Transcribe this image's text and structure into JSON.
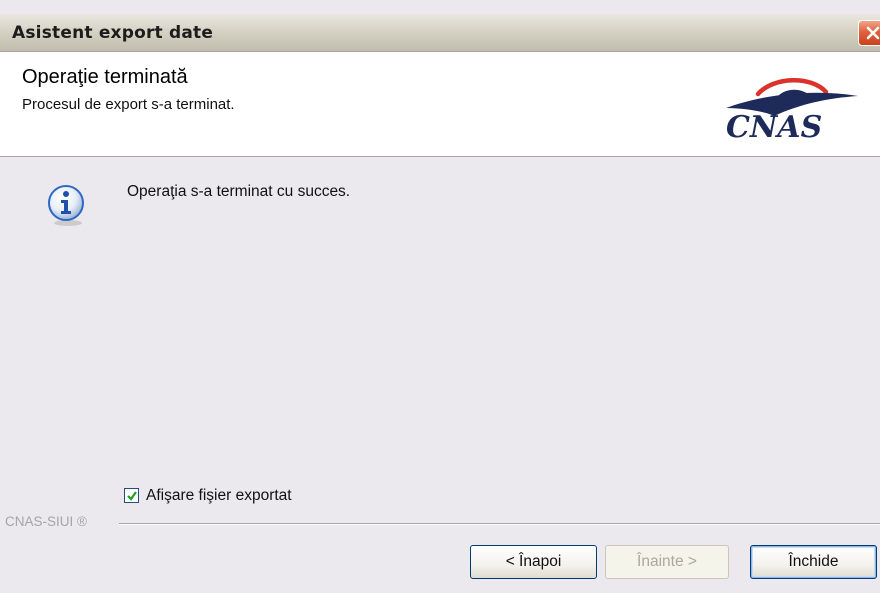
{
  "window": {
    "title": "Asistent export date"
  },
  "header": {
    "title": "Operaţie terminată",
    "subtitle": "Procesul de export s-a terminat.",
    "logo_text": "CNAS"
  },
  "body": {
    "message": "Operaţia s-a terminat cu succes.",
    "show_file_checkbox": {
      "label": "Afişare fişier exportat",
      "checked": true
    }
  },
  "footer": {
    "brand": "CNAS-SIUI ®"
  },
  "buttons": {
    "back": "< Înapoi",
    "next": "Înainte >",
    "close": "Închide"
  },
  "colors": {
    "accent_border": "#003c74",
    "logo_red": "#d9332b",
    "logo_navy": "#1d2a5a",
    "info_blue": "#2f67c4"
  }
}
